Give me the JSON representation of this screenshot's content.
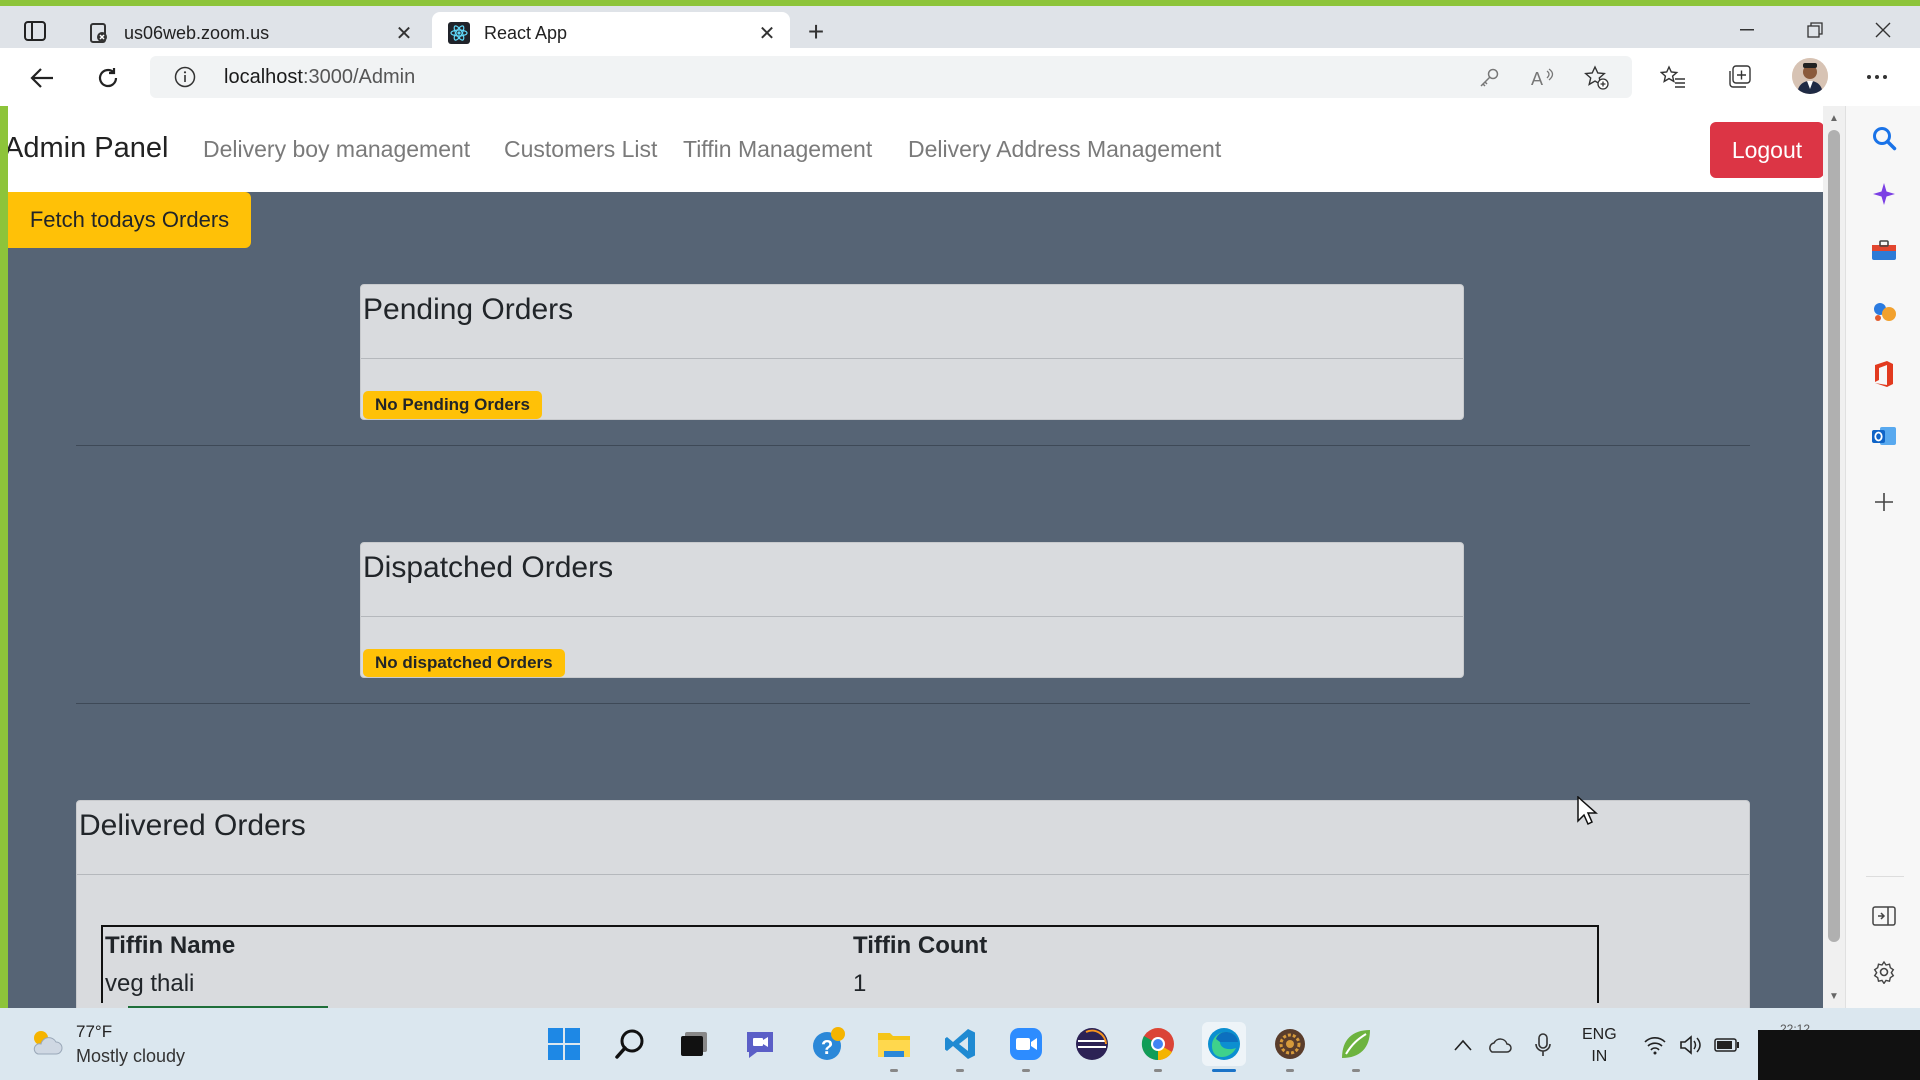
{
  "browser": {
    "tabs": [
      {
        "title": "us06web.zoom.us",
        "active": false
      },
      {
        "title": "React App",
        "active": true
      }
    ],
    "address": {
      "host": "localhost",
      "path": ":3000/Admin"
    }
  },
  "app": {
    "brand": "Admin Panel",
    "nav": [
      "Delivery boy management",
      "Customers List",
      "Tiffin Management",
      "Delivery Address Management"
    ],
    "logout_label": "Logout",
    "fetch_label": "Fetch todays Orders"
  },
  "pending": {
    "title": "Pending Orders",
    "badge": "No Pending Orders"
  },
  "dispatched": {
    "title": "Dispatched Orders",
    "badge": "No dispatched Orders"
  },
  "delivered": {
    "title": "Delivered Orders",
    "columns": [
      "Tiffin Name",
      "Tiffin Count"
    ],
    "rows": [
      [
        "veg thali",
        "1"
      ]
    ]
  },
  "taskbar": {
    "weather_temp": "77°F",
    "weather_desc": "Mostly cloudy",
    "lang_line1": "ENG",
    "lang_line2": "IN",
    "clock_peek": "22:12"
  },
  "colors": {
    "page_bg": "#566475",
    "danger": "#dc3545",
    "warning": "#ffc107",
    "card_bg": "#d9dbde"
  }
}
